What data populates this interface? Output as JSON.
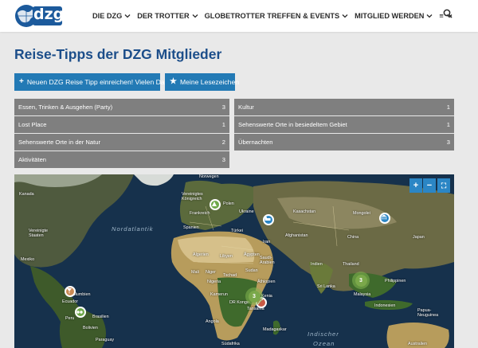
{
  "header": {
    "logo_text": "dzg",
    "nav": [
      {
        "label": "DIE DZG"
      },
      {
        "label": "DER TROTTER"
      },
      {
        "label": "GLOBETROTTER TREFFEN & EVENTS"
      },
      {
        "label": "MITGLIED WERDEN"
      },
      {
        "label": "≡"
      }
    ]
  },
  "page": {
    "title": "Reise-Tipps der DZG Mitglieder"
  },
  "buttons": {
    "new_tip": "Neuen DZG Reise Tipp einreichen! Vielen Dank",
    "reading_list": "Meine Lesezeichen"
  },
  "categories_left": [
    {
      "label": "Essen, Trinken & Ausgehen (Party)",
      "count": "3"
    },
    {
      "label": "Lost Place",
      "count": "1"
    },
    {
      "label": "Sehenswerte Orte in der Natur",
      "count": "2"
    },
    {
      "label": "Aktivitäten",
      "count": "3"
    }
  ],
  "categories_right": [
    {
      "label": "Kultur",
      "count": "1"
    },
    {
      "label": "Sehenswerte Orte in besiedeltem Gebiet",
      "count": "1"
    },
    {
      "label": "Übernachten",
      "count": "3"
    }
  ],
  "map": {
    "zoom_in": "+",
    "zoom_out": "−",
    "fullscreen": "⛶",
    "oceans": [
      "Nordatlantik",
      "Indischer",
      "Ozean"
    ],
    "labels": [
      "Norwegen",
      "Kanada",
      "Vereinigtes Königreich",
      "Polen",
      "Ukraine",
      "Frankreich",
      "Kasachstan",
      "Mongolei",
      "Vereinigte Staaten",
      "Spanien",
      "Türkei",
      "Iran",
      "Afghanistan",
      "China",
      "Japan",
      "Mexiko",
      "Algerien",
      "Libyen",
      "Ägypten",
      "Saudi-Arabien",
      "Indien",
      "Thailand",
      "Mali",
      "Niger",
      "Tschad",
      "Sudan",
      "Nigeria",
      "Äthiopien",
      "Kolumbien",
      "Ecuador",
      "Kamerun",
      "Kenia",
      "DR Kongo",
      "Tansania",
      "Malaysia",
      "Philippinen",
      "Indonesien",
      "Peru",
      "Brasilien",
      "Bolivien",
      "Angola",
      "Paraguay",
      "Südafrika",
      "Madagaskar",
      "Papua-Neuguinea",
      "Australien",
      "Sri Lanka"
    ],
    "clusters": [
      "3",
      "3"
    ],
    "colors": {
      "accent": "#237ab5",
      "category": "#7f7f7f",
      "title": "#1c4e8a",
      "map_ctrl": "#2b86c5"
    }
  }
}
